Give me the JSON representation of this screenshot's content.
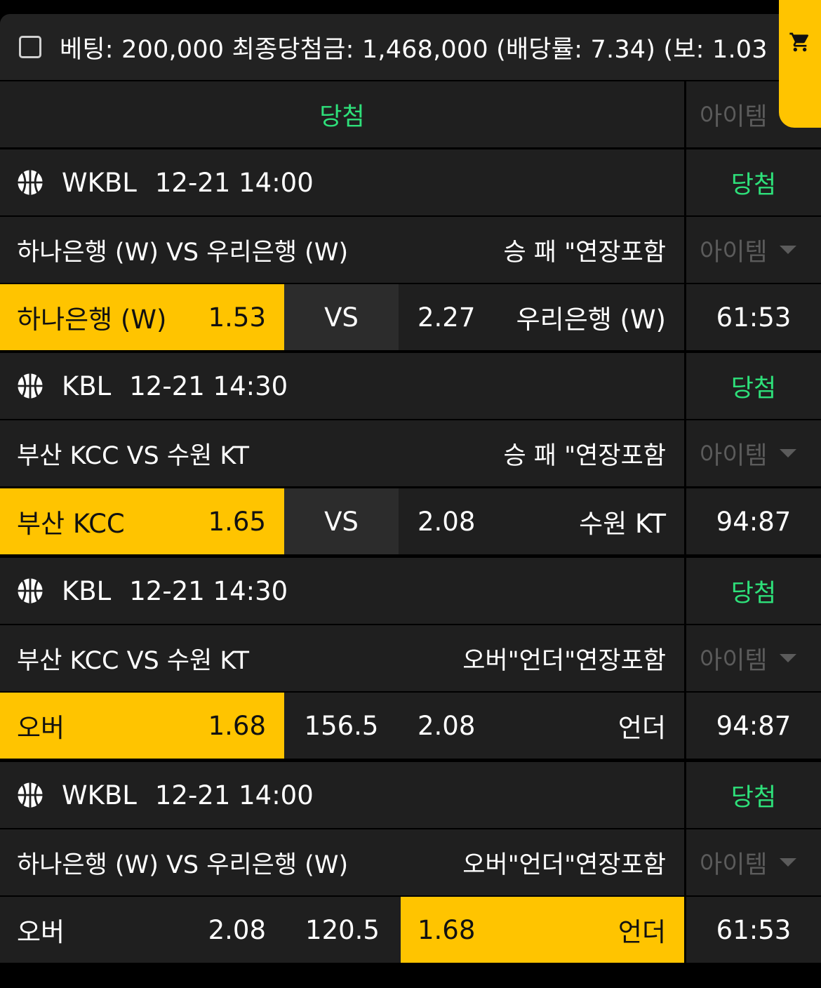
{
  "summary": {
    "text": "베팅: 200,000 최종당첨금: 1,468,000 (배당률: 7.34) (보: 1.03"
  },
  "cart": {
    "icon": "cart-icon"
  },
  "header": {
    "result": "당첨",
    "item": "아이템"
  },
  "bets": [
    {
      "league": "WKBL",
      "datetime": "12-21 14:00",
      "status": "당첨",
      "matchup": "하나은행 (W) VS 우리은행 (W)",
      "market": "승 패 \"연장포함",
      "item_label": "아이템",
      "home": "하나은행 (W)",
      "home_odds": "1.53",
      "mid": "VS",
      "away_odds": "2.27",
      "away": "우리은행 (W)",
      "score": "61:53",
      "selected": "home"
    },
    {
      "league": "KBL",
      "datetime": "12-21 14:30",
      "status": "당첨",
      "matchup": "부산 KCC VS 수원 KT",
      "market": "승 패 \"연장포함",
      "item_label": "아이템",
      "home": "부산 KCC",
      "home_odds": "1.65",
      "mid": "VS",
      "away_odds": "2.08",
      "away": "수원 KT",
      "score": "94:87",
      "selected": "home"
    },
    {
      "league": "KBL",
      "datetime": "12-21 14:30",
      "status": "당첨",
      "matchup": "부산 KCC VS 수원 KT",
      "market": "오버\"언더\"연장포함",
      "item_label": "아이템",
      "home": "오버",
      "home_odds": "1.68",
      "mid": "156.5",
      "away_odds": "2.08",
      "away": "언더",
      "score": "94:87",
      "selected": "home"
    },
    {
      "league": "WKBL",
      "datetime": "12-21 14:00",
      "status": "당첨",
      "matchup": "하나은행 (W) VS 우리은행 (W)",
      "market": "오버\"언더\"연장포함",
      "item_label": "아이템",
      "home": "오버",
      "home_odds": "2.08",
      "mid": "120.5",
      "away_odds": "1.68",
      "away": "언더",
      "score": "61:53",
      "selected": "away"
    }
  ],
  "colors": {
    "accent": "#ffc400",
    "win": "#2ee07a",
    "muted": "#5b5b5b",
    "row_bg": "#1f1f1f"
  }
}
